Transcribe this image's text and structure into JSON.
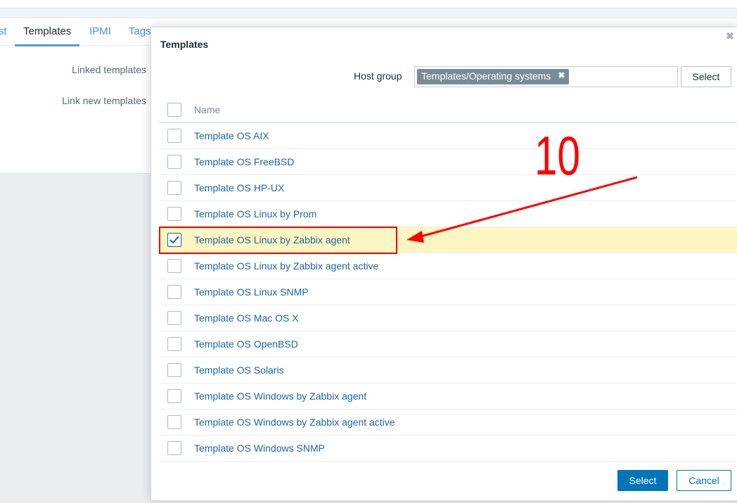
{
  "tabs": [
    {
      "label": "st"
    },
    {
      "label": "Templates",
      "active": true
    },
    {
      "label": "IPMI"
    },
    {
      "label": "Tags"
    }
  ],
  "form": {
    "linked_label": "Linked templates",
    "link_new_label": "Link new templates"
  },
  "modal": {
    "title": "Templates",
    "host_group_label": "Host group",
    "host_group_value": "Templates/Operating systems",
    "select_label": "Select",
    "column_name": "Name",
    "rows": [
      {
        "name": "Template OS AIX",
        "checked": false
      },
      {
        "name": "Template OS FreeBSD",
        "checked": false
      },
      {
        "name": "Template OS HP-UX",
        "checked": false
      },
      {
        "name": "Template OS Linux by Prom",
        "checked": false
      },
      {
        "name": "Template OS Linux by Zabbix agent",
        "checked": true
      },
      {
        "name": "Template OS Linux by Zabbix agent active",
        "checked": false
      },
      {
        "name": "Template OS Linux SNMP",
        "checked": false
      },
      {
        "name": "Template OS Mac OS X",
        "checked": false
      },
      {
        "name": "Template OS OpenBSD",
        "checked": false
      },
      {
        "name": "Template OS Solaris",
        "checked": false
      },
      {
        "name": "Template OS Windows by Zabbix agent",
        "checked": false
      },
      {
        "name": "Template OS Windows by Zabbix agent active",
        "checked": false
      },
      {
        "name": "Template OS Windows SNMP",
        "checked": false
      }
    ],
    "footer_select": "Select",
    "footer_cancel": "Cancel"
  },
  "annotation": {
    "step": "10",
    "color": "#ff0000"
  },
  "colors": {
    "link": "#1f65a6",
    "primary": "#0275b8",
    "selected_row": "#fcf7c2"
  }
}
